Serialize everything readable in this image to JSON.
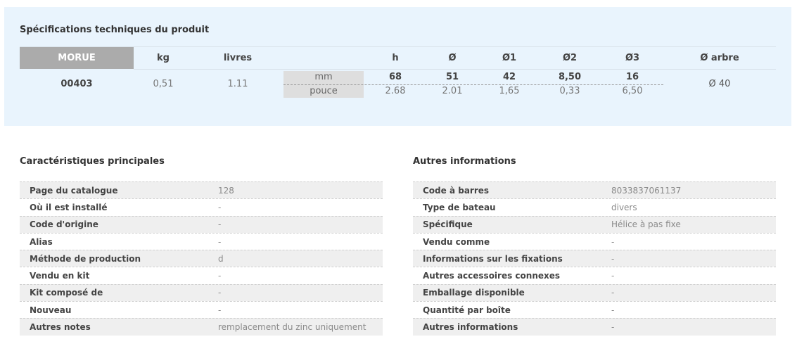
{
  "spec": {
    "title": "Spécifications techniques du produit",
    "headers": {
      "morue": "MORUE",
      "kg": "kg",
      "livres": "livres",
      "h": "h",
      "d": "Ø",
      "d1": "Ø1",
      "d2": "Ø2",
      "d3": "Ø3",
      "arbre": "Ø arbre"
    },
    "row": {
      "code": "00403",
      "kg": "0,51",
      "livres": "1.11",
      "unit_mm": "mm",
      "unit_pouce": "pouce",
      "mm": {
        "h": "68",
        "d": "51",
        "d1": "42",
        "d2": "8,50",
        "d3": "16"
      },
      "pouce": {
        "h": "2.68",
        "d": "2.01",
        "d1": "1,65",
        "d2": "0,33",
        "d3": "6,50"
      },
      "arbre": "Ø 40"
    }
  },
  "main": {
    "title": "Caractéristiques principales",
    "rows": [
      {
        "label": "Page du catalogue",
        "value": "128"
      },
      {
        "label": "Où il est installé",
        "value": "-"
      },
      {
        "label": "Code d'origine",
        "value": "-"
      },
      {
        "label": "Alias",
        "value": "-"
      },
      {
        "label": "Méthode de production",
        "value": "d"
      },
      {
        "label": "Vendu en kit",
        "value": "-"
      },
      {
        "label": "Kit composé de",
        "value": "-"
      },
      {
        "label": "Nouveau",
        "value": "-"
      },
      {
        "label": "Autres notes",
        "value": "remplacement du zinc uniquement"
      }
    ]
  },
  "other": {
    "title": "Autres informations",
    "rows": [
      {
        "label": "Code à barres",
        "value": "8033837061137"
      },
      {
        "label": "Type de bateau",
        "value": "divers"
      },
      {
        "label": "Spécifique",
        "value": "Hélice à pas fixe"
      },
      {
        "label": "Vendu comme",
        "value": "-"
      },
      {
        "label": "Informations sur les fixations",
        "value": "-"
      },
      {
        "label": "Autres accessoires connexes",
        "value": "-"
      },
      {
        "label": "Emballage disponible",
        "value": "-"
      },
      {
        "label": "Quantité par boîte",
        "value": "-"
      },
      {
        "label": "Autres informations",
        "value": "-"
      }
    ]
  }
}
